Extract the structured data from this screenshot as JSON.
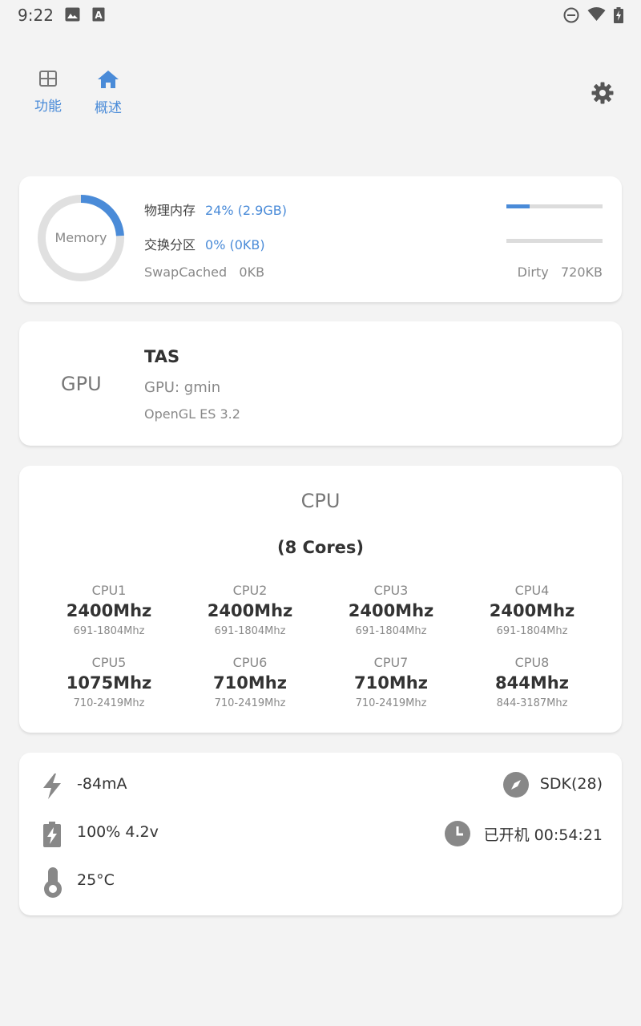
{
  "status_bar": {
    "time": "9:22",
    "icons_left": [
      "image-icon",
      "text-a-icon"
    ],
    "icons_right": [
      "do-not-disturb-icon",
      "wifi-icon",
      "battery-charging-icon"
    ]
  },
  "tabs": [
    {
      "label": "功能",
      "icon": "grid-icon"
    },
    {
      "label": "概述",
      "icon": "home-icon"
    }
  ],
  "accent_color": "#4a8bd8",
  "memory": {
    "donut_label": "Memory",
    "usage_fraction": 0.24,
    "physical_label": "物理内存",
    "physical_value": "24% (2.9GB)",
    "physical_fraction": 0.24,
    "swap_label": "交换分区",
    "swap_value": "0% (0KB)",
    "swap_fraction": 0,
    "swapcached_label": "SwapCached",
    "swapcached_value": "0KB",
    "dirty_label": "Dirty",
    "dirty_value": "720KB"
  },
  "gpu": {
    "label": "GPU",
    "vendor": "TAS",
    "model": "GPU: gmin",
    "opengl": "OpenGL ES 3.2"
  },
  "cpu": {
    "title": "CPU",
    "cores_label": "(8 Cores)",
    "cores": [
      {
        "name": "CPU1",
        "freq": "2400Mhz",
        "range": "691-1804Mhz"
      },
      {
        "name": "CPU2",
        "freq": "2400Mhz",
        "range": "691-1804Mhz"
      },
      {
        "name": "CPU3",
        "freq": "2400Mhz",
        "range": "691-1804Mhz"
      },
      {
        "name": "CPU4",
        "freq": "2400Mhz",
        "range": "691-1804Mhz"
      },
      {
        "name": "CPU5",
        "freq": "1075Mhz",
        "range": "710-2419Mhz"
      },
      {
        "name": "CPU6",
        "freq": "710Mhz",
        "range": "710-2419Mhz"
      },
      {
        "name": "CPU7",
        "freq": "710Mhz",
        "range": "710-2419Mhz"
      },
      {
        "name": "CPU8",
        "freq": "844Mhz",
        "range": "844-3187Mhz"
      }
    ]
  },
  "battery": {
    "current": "-84mA",
    "level_voltage": "100% 4.2v",
    "temperature": "25°C",
    "sdk": "SDK(28)",
    "uptime": "已开机 00:54:21"
  }
}
